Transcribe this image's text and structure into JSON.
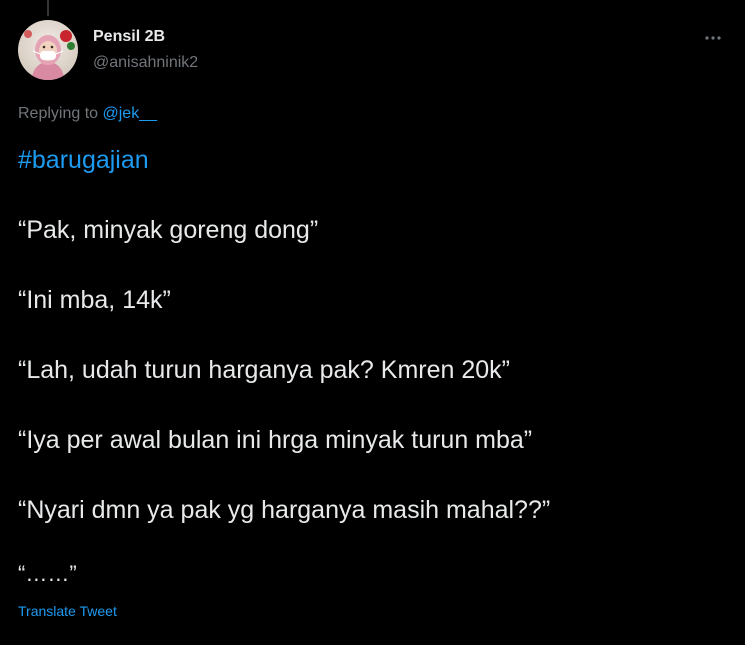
{
  "tweet": {
    "author": {
      "display_name": "Pensil 2B",
      "handle": "@anisahninik2"
    },
    "replying_to": {
      "prefix": "Replying to",
      "mention": "@jek__"
    },
    "hashtag": "#barugajian",
    "lines": [
      "“Pak, minyak goreng dong”",
      "“Ini mba, 14k”",
      "“Lah, udah turun harganya pak? Kmren 20k”",
      "“Iya per awal bulan ini hrga minyak turun mba”",
      "“Nyari dmn ya pak yg harganya masih mahal??”",
      "“……”"
    ],
    "translate_label": "Translate Tweet"
  },
  "icons": {
    "more": "more-horizontal-icon"
  },
  "colors": {
    "background": "#000000",
    "text": "#e7e9ea",
    "secondary_text": "#71767b",
    "accent": "#1d9bf0"
  }
}
